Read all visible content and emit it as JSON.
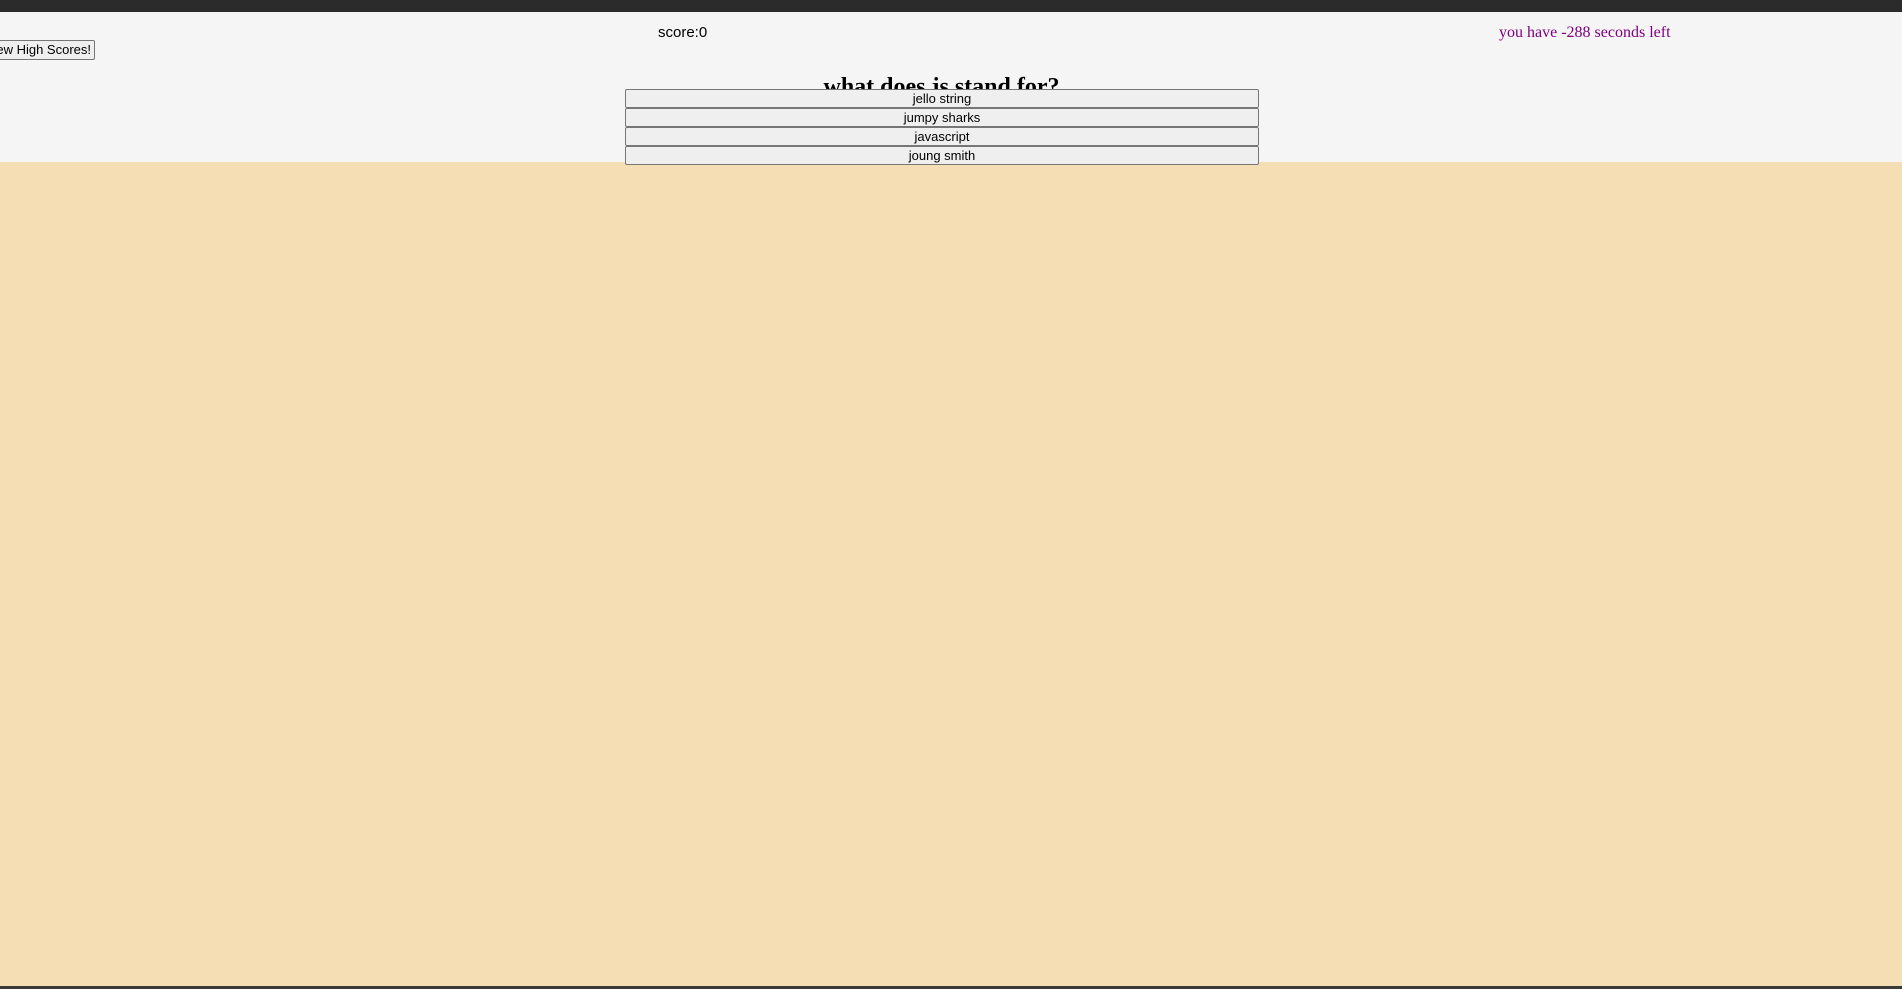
{
  "header": {
    "score_label": "score:0",
    "timer_label": "you have -288 seconds left"
  },
  "buttons": {
    "view_high_scores": "ew High Scores!"
  },
  "quiz": {
    "question": "what does js stand for?",
    "answers": [
      "jello string",
      "jumpy sharks",
      "javascript",
      "joung smith"
    ]
  },
  "colors": {
    "page_background": "#f5deb3",
    "panel_background": "#f5f5f5",
    "timer_text": "#800080",
    "browser_bar": "#2b2b2b"
  }
}
